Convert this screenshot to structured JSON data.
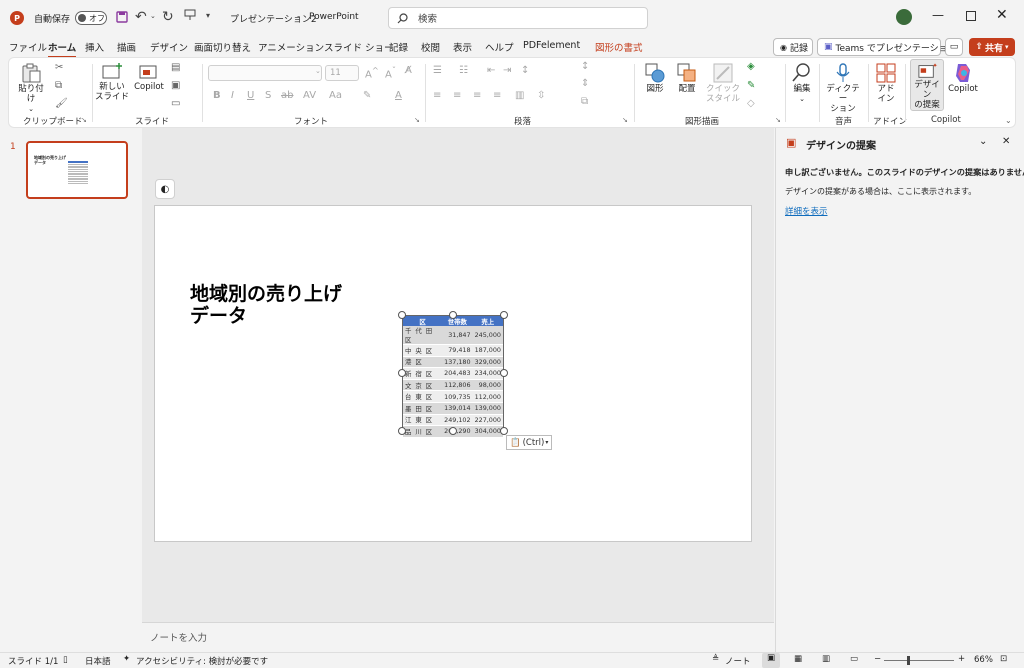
{
  "titlebar": {
    "autosave_label": "自動保存",
    "autosave_state": "オフ",
    "document_title": "プレゼンテーション2",
    "separator": "-",
    "app_name": "PowerPoint",
    "search_placeholder": "検索"
  },
  "tabs": [
    "ファイル",
    "ホーム",
    "挿入",
    "描画",
    "デザイン",
    "画面切り替え",
    "アニメーション",
    "スライド ショー",
    "記録",
    "校閲",
    "表示",
    "ヘルプ",
    "PDFelement",
    "図形の書式"
  ],
  "header_buttons": {
    "record": "記録",
    "teams": "Teams でプレゼンテーション",
    "share": "共有"
  },
  "ribbon": {
    "paste": "貼り付け",
    "new_slide_1": "新しい",
    "new_slide_2": "スライド",
    "copilot": "Copilot",
    "font_size": "11",
    "shape": "図形",
    "arrange": "配置",
    "quick_style_1": "クイック",
    "quick_style_2": "スタイル",
    "edit": "編集",
    "dictate_1": "ディクテー",
    "dictate_2": "ション",
    "addin_1": "アド",
    "addin_2": "イン",
    "designer_1": "デザイン",
    "designer_2": "の提案",
    "copilot2": "Copilot",
    "groups": {
      "clipboard": "クリップボード",
      "slides": "スライド",
      "font": "フォント",
      "paragraph": "段落",
      "drawing": "図形描画",
      "voice": "音声",
      "addins": "アドイン",
      "copilot": "Copilot"
    }
  },
  "thumbnail": {
    "number": "1",
    "title": "地域別の売り上げデータ"
  },
  "slide": {
    "title_line1": "地域別の売り上げ",
    "title_line2": "データ",
    "table_headers": [
      "区",
      "世帯数",
      "売上"
    ],
    "table_rows": [
      [
        "千代田区",
        "31,847",
        "245,000"
      ],
      [
        "中央区",
        "79,418",
        "187,000"
      ],
      [
        "港区",
        "137,180",
        "329,000"
      ],
      [
        "新宿区",
        "204,483",
        "234,000"
      ],
      [
        "文京区",
        "112,806",
        "98,000"
      ],
      [
        "台東区",
        "109,735",
        "112,000"
      ],
      [
        "墨田区",
        "139,014",
        "139,000"
      ],
      [
        "江東区",
        "249,102",
        "227,000"
      ],
      [
        "品川区",
        "205,290",
        "304,000"
      ]
    ],
    "paste_options": "(Ctrl)"
  },
  "notes_placeholder": "ノートを入力",
  "designer_pane": {
    "title": "デザインの提案",
    "message": "申し訳ございません。このスライドのデザインの提案はありません。",
    "submessage": "デザインの提案がある場合は、ここに表示されます。",
    "details_link": "詳細を表示"
  },
  "statusbar": {
    "slide_info": "スライド 1/1",
    "language": "日本語",
    "accessibility": "アクセシビリティ: 検討が必要です",
    "notes": "ノート",
    "zoom": "66%"
  },
  "colors": {
    "accent": "#c43e1c",
    "table_header": "#4472c4",
    "link": "#0f6cbd"
  }
}
